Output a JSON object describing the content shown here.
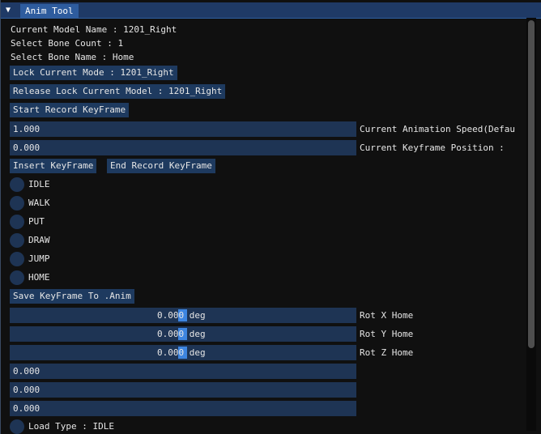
{
  "window": {
    "title": "Anim Tool",
    "collapse_glyph": "▼"
  },
  "info": {
    "model_name": "Current Model Name : 1201_Right",
    "bone_count": "Select Bone Count : 1",
    "bone_name": "Select Bone Name : Home"
  },
  "buttons": {
    "lock": "Lock Current Mode : 1201_Right",
    "release": "Release Lock Current Model : 1201_Right",
    "start_record": "Start Record KeyFrame",
    "insert": "Insert KeyFrame",
    "end_record": "End Record KeyFrame",
    "save": "Save KeyFrame To .Anim"
  },
  "fields": {
    "speed": {
      "value": "1.000",
      "label": "Current Animation Speed(Defau"
    },
    "position": {
      "value": "0.000",
      "label": "Current Keyframe Position :"
    }
  },
  "radios": [
    "IDLE",
    "WALK",
    "PUT",
    "DRAW",
    "JUMP",
    "HOME"
  ],
  "rotation_sliders": [
    {
      "value": "0.000 deg",
      "label": "Rot X Home"
    },
    {
      "value": "0.000 deg",
      "label": "Rot Y Home"
    },
    {
      "value": "0.000 deg",
      "label": "Rot Z Home"
    }
  ],
  "extra_fields": [
    "0.000",
    "0.000",
    "0.000"
  ],
  "load_type": "Load Type : IDLE",
  "colors": {
    "title_bg": "#1f3a66",
    "title_tab": "#2e5c9e",
    "button_bg": "#1e3a5f",
    "field_bg": "#1e3454",
    "slider_grab": "#3d85e0",
    "window_bg": "#101010"
  }
}
